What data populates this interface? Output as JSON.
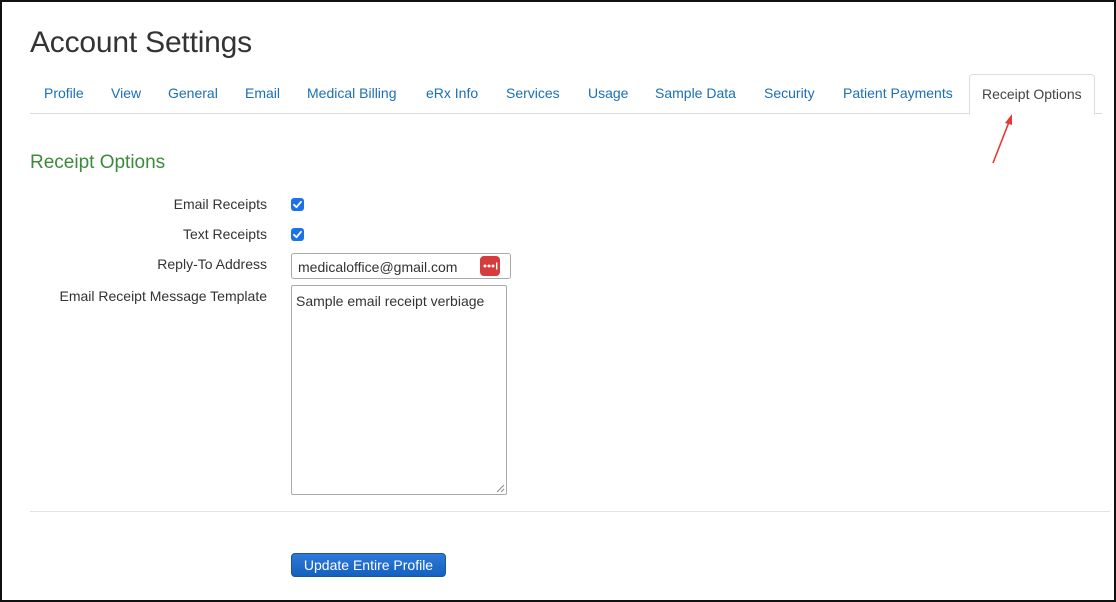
{
  "page": {
    "title": "Account Settings"
  },
  "tabs": [
    {
      "label": "Profile"
    },
    {
      "label": "View"
    },
    {
      "label": "General"
    },
    {
      "label": "Email"
    },
    {
      "label": "Medical Billing"
    },
    {
      "label": "eRx Info"
    },
    {
      "label": "Services"
    },
    {
      "label": "Usage"
    },
    {
      "label": "Sample Data"
    },
    {
      "label": "Security"
    },
    {
      "label": "Patient Payments"
    },
    {
      "label": "Receipt Options",
      "active": true
    }
  ],
  "section": {
    "title": "Receipt Options"
  },
  "form": {
    "email_receipts": {
      "label": "Email Receipts",
      "checked": true
    },
    "text_receipts": {
      "label": "Text Receipts",
      "checked": true
    },
    "reply_to": {
      "label": "Reply-To Address",
      "value": "medicaloffice@gmail.com"
    },
    "template": {
      "label": "Email Receipt Message Template",
      "value": "Sample email receipt verbiage"
    }
  },
  "actions": {
    "update_label": "Update Entire Profile"
  },
  "colors": {
    "tab_link": "#1a6fb5",
    "section_title": "#3c8a3c",
    "checkbox": "#1a73e8",
    "button": "#1a6fd0",
    "password_manager_icon": "#d63c3c",
    "annotation_arrow": "#e53935"
  },
  "icons": {
    "checkbox": "checkmark-icon",
    "password_manager": "password-manager-icon",
    "annotation": "red-arrow-icon",
    "resize": "resize-grip-icon"
  }
}
